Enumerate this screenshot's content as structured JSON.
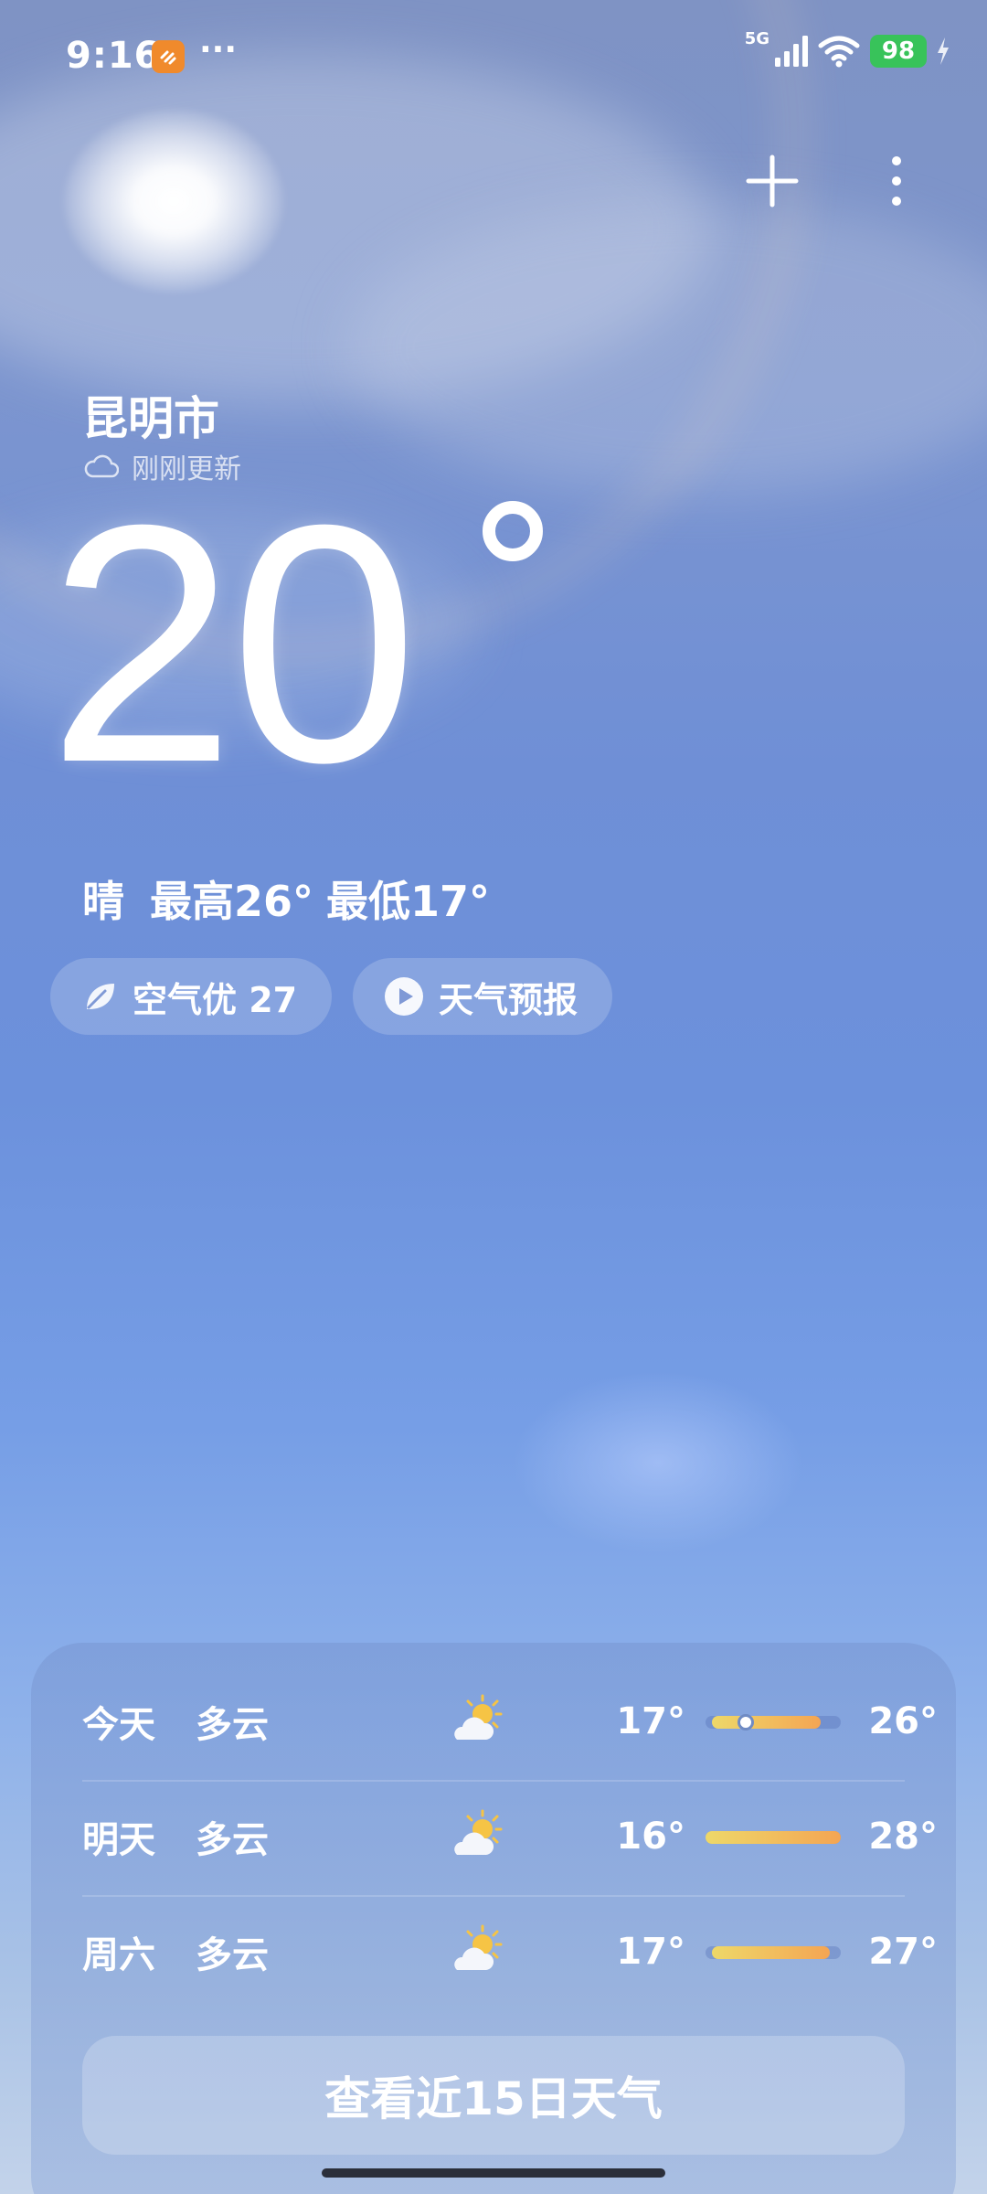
{
  "status_bar": {
    "time": "9:16",
    "dots": "···",
    "network": "5G",
    "battery": "98"
  },
  "location": {
    "city": "昆明市",
    "updated": "刚刚更新"
  },
  "current": {
    "temperature": "20",
    "condition": "晴",
    "high": "最高26°",
    "low": "最低17°"
  },
  "pills": {
    "air_quality": "空气优 27",
    "forecast": "天气预报"
  },
  "daily": [
    {
      "day": "今天",
      "condition": "多云",
      "icon": "partly-cloudy-icon",
      "low": "17°",
      "high": "26°",
      "bar_start": 0.05,
      "bar_end": 0.85,
      "current_marker": 0.3
    },
    {
      "day": "明天",
      "condition": "多云",
      "icon": "partly-cloudy-icon",
      "low": "16°",
      "high": "28°",
      "bar_start": 0.0,
      "bar_end": 1.0
    },
    {
      "day": "周六",
      "condition": "多云",
      "icon": "partly-cloudy-icon",
      "low": "17°",
      "high": "27°",
      "bar_start": 0.05,
      "bar_end": 0.92
    }
  ],
  "more_button": "查看近15日天气",
  "colors": {
    "battery": "#38c35a",
    "app_badge": "#f08a2c",
    "bar_start": "#eed869",
    "bar_end": "#f4a553"
  }
}
